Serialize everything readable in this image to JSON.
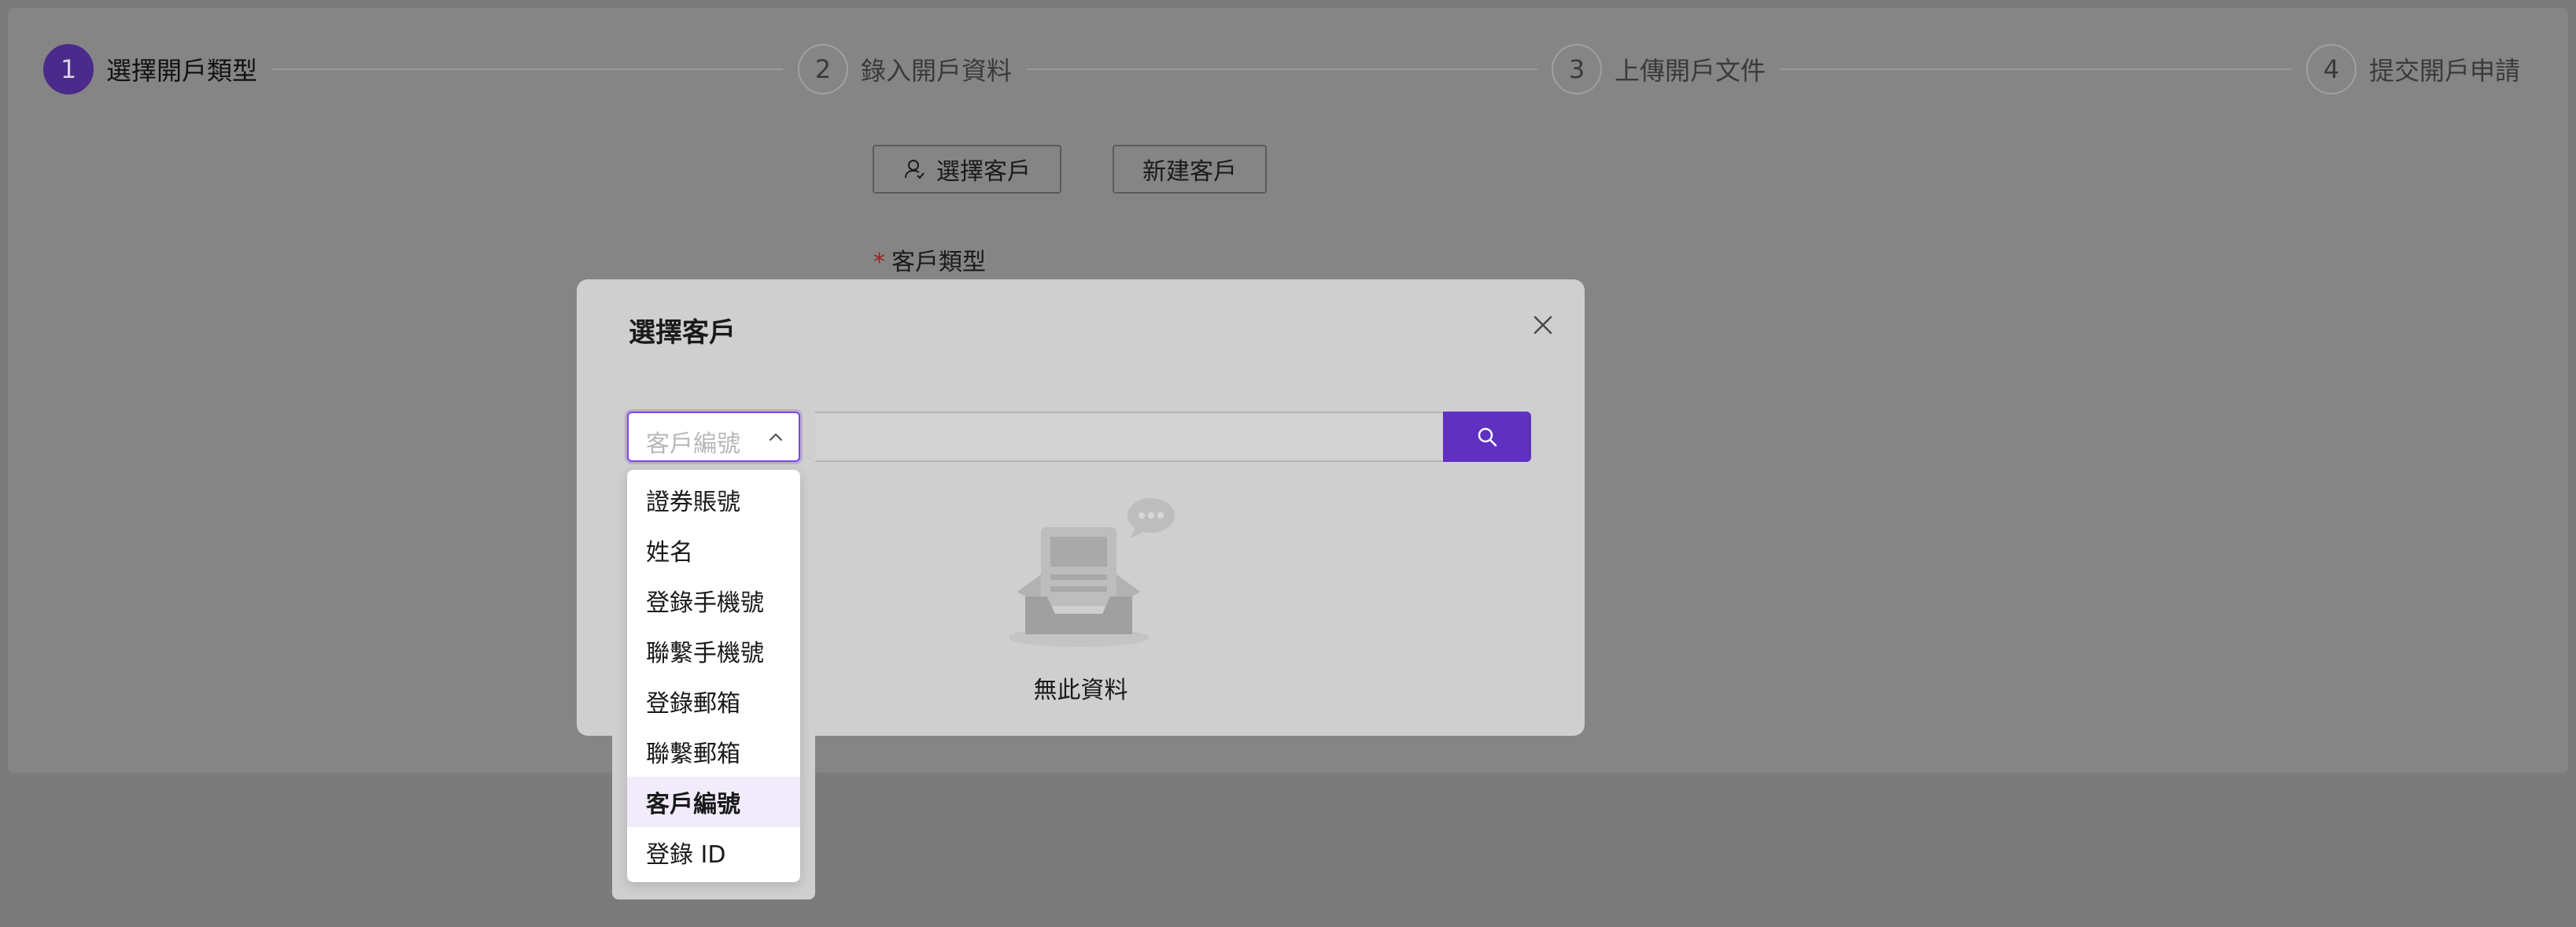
{
  "steps": [
    {
      "number": "1",
      "label": "選擇開戶類型",
      "active": true
    },
    {
      "number": "2",
      "label": "錄入開戶資料",
      "active": false
    },
    {
      "number": "3",
      "label": "上傳開戶文件",
      "active": false
    },
    {
      "number": "4",
      "label": "提交開戶申請",
      "active": false
    }
  ],
  "actions": {
    "select_customer": "選擇客戶",
    "new_customer": "新建客戶"
  },
  "form": {
    "customer_type_label": "客戶類型",
    "required_mark": "*"
  },
  "modal": {
    "title": "選擇客戶",
    "close_icon": "close-icon",
    "search_icon": "search-icon",
    "search_field_value": "",
    "empty_text": "無此資料"
  },
  "search_type_select": {
    "placeholder": "客戶編號",
    "options": [
      "證券賬號",
      "姓名",
      "登錄手機號",
      "聯繫手機號",
      "登錄郵箱",
      "聯繫郵箱",
      "客戶編號",
      "登錄 ID"
    ],
    "selected": "客戶編號"
  },
  "colors": {
    "accent": "#6030c0",
    "step_active": "#4a2a8a",
    "required": "#a02020",
    "selected_option_bg": "#f1ebfb"
  }
}
